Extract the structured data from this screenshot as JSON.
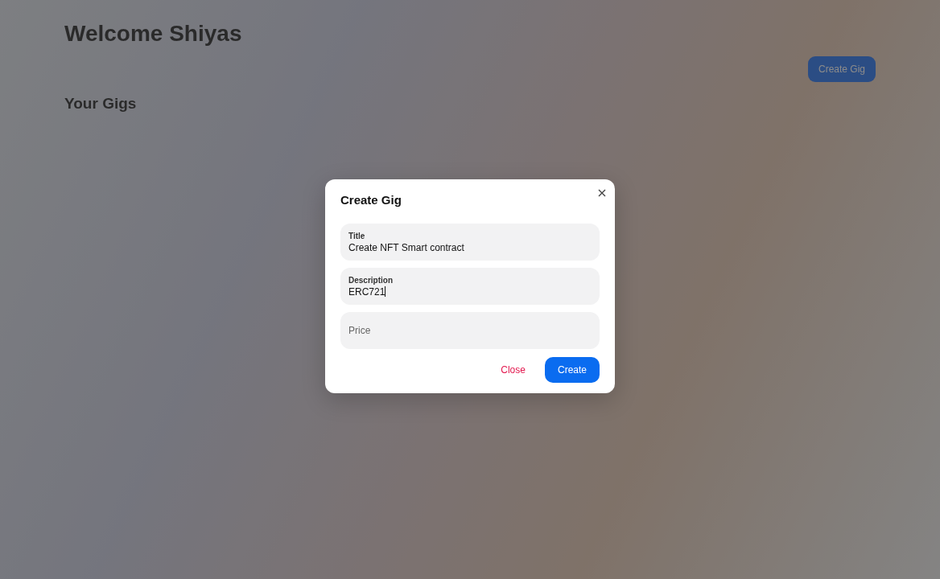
{
  "page": {
    "heading": "Welcome Shiyas",
    "create_button": "Create Gig",
    "section_title": "Your Gigs"
  },
  "modal": {
    "title": "Create Gig",
    "fields": [
      {
        "label": "Title",
        "value": "Create NFT Smart contract",
        "focused": false
      },
      {
        "label": "Description",
        "value": "ERC721",
        "focused": true
      },
      {
        "label": "Price",
        "focused": false
      }
    ],
    "buttons": [
      {
        "label": "Close",
        "kind": "text"
      },
      {
        "label": "Create",
        "kind": "primary"
      }
    ]
  }
}
